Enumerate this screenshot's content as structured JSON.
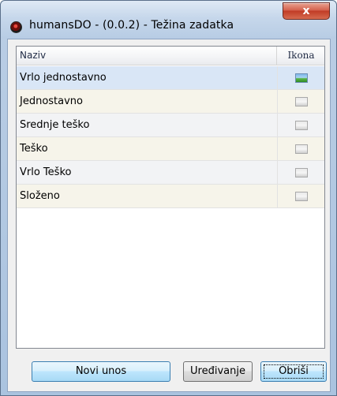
{
  "window": {
    "title": "humansDO - (0.0.2) - Težina zadatka",
    "close_label": "x"
  },
  "grid": {
    "columns": [
      "Naziv",
      "Ikona"
    ],
    "rows": [
      {
        "name": "Vrlo jednostavno",
        "icon": "image-color-icon",
        "selected": true
      },
      {
        "name": "Jednostavno",
        "icon": "image-gray-icon"
      },
      {
        "name": "Srednje teško",
        "icon": "image-gray-icon"
      },
      {
        "name": "Teško",
        "icon": "image-gray-icon"
      },
      {
        "name": "Vrlo Teško",
        "icon": "image-gray-icon"
      },
      {
        "name": "Složeno",
        "icon": "image-gray-icon"
      }
    ]
  },
  "buttons": {
    "new_entry": "Novi unos",
    "edit": "Uređivanje",
    "delete": "Obriši"
  }
}
